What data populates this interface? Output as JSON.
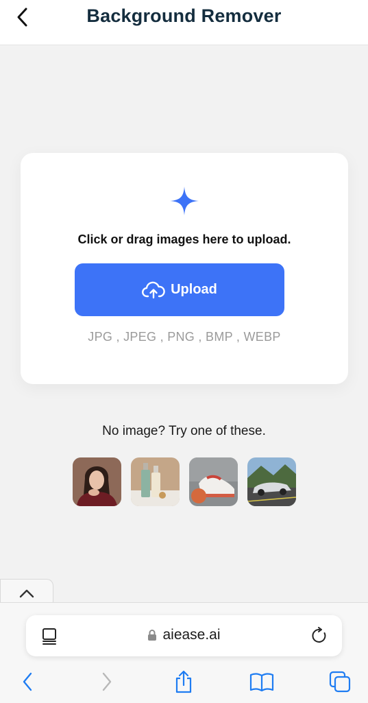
{
  "header": {
    "title": "Background Remover"
  },
  "upload": {
    "instruction": "Click or drag images here to upload.",
    "button_label": "Upload",
    "formats": "JPG , JPEG , PNG , BMP , WEBP"
  },
  "samples": {
    "label": "No image? Try one of these.",
    "items": [
      "woman-portrait-thumbnail",
      "cosmetic-bottles-thumbnail",
      "sneaker-thumbnail",
      "sports-car-thumbnail"
    ]
  },
  "browser": {
    "url": "aiease.ai"
  },
  "colors": {
    "accent": "#3d73f7",
    "title": "#142d3e",
    "ios_blue": "#1e7cf2"
  }
}
